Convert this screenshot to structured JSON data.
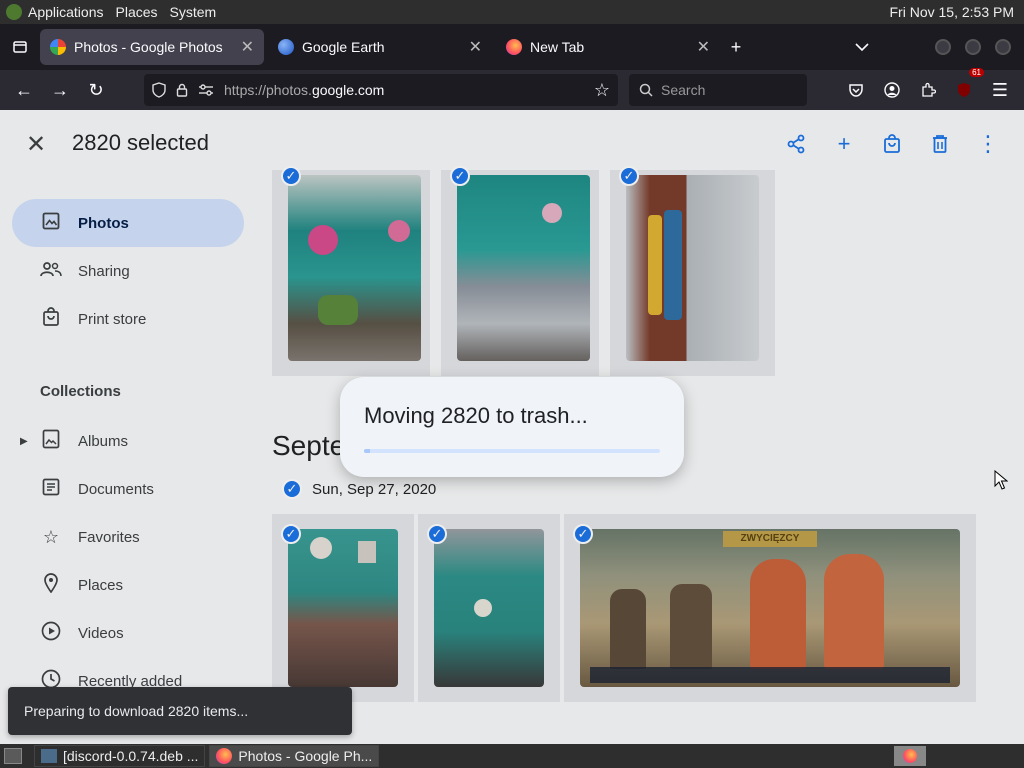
{
  "panel": {
    "applications": "Applications",
    "places": "Places",
    "system": "System",
    "clock": "Fri Nov 15,  2:53 PM"
  },
  "tabs": [
    {
      "title": "Photos - Google Photos",
      "active": true,
      "icon": "google-photos-icon"
    },
    {
      "title": "Google Earth",
      "active": false,
      "icon": "google-earth-icon"
    },
    {
      "title": "New Tab",
      "active": false,
      "icon": "firefox-icon"
    }
  ],
  "navbar": {
    "url_prefix": "https://photos.",
    "url_domain": "google.com",
    "search_placeholder": "Search",
    "extension_badge": "61"
  },
  "appbar": {
    "selected_count": "2820 selected"
  },
  "sidebar": {
    "items": [
      {
        "label": "Photos",
        "icon": "photo-icon",
        "active": true
      },
      {
        "label": "Sharing",
        "icon": "people-icon",
        "active": false
      },
      {
        "label": "Print store",
        "icon": "bag-icon",
        "active": false
      }
    ],
    "collections_heading": "Collections",
    "collections": [
      {
        "label": "Albums",
        "icon": "album-icon"
      },
      {
        "label": "Documents",
        "icon": "document-icon"
      },
      {
        "label": "Favorites",
        "icon": "star-icon"
      },
      {
        "label": "Places",
        "icon": "place-icon"
      },
      {
        "label": "Videos",
        "icon": "video-icon"
      },
      {
        "label": "Recently added",
        "icon": "clock-icon"
      }
    ]
  },
  "grid": {
    "section_title": "Septe",
    "date_label": "Sun, Sep 27, 2020",
    "game_banner": "ZWYCIĘZCY"
  },
  "dialog": {
    "message": "Moving 2820 to trash...",
    "progress": 0.02
  },
  "snackbar": {
    "message": "Preparing to download 2820 items..."
  },
  "taskbar": {
    "items": [
      {
        "label": "[discord-0.0.74.deb ...",
        "active": false
      },
      {
        "label": "Photos - Google Ph...",
        "active": true
      }
    ]
  },
  "colors": {
    "accent": "#1a73e8",
    "active_nav": "#d3e3fd"
  }
}
